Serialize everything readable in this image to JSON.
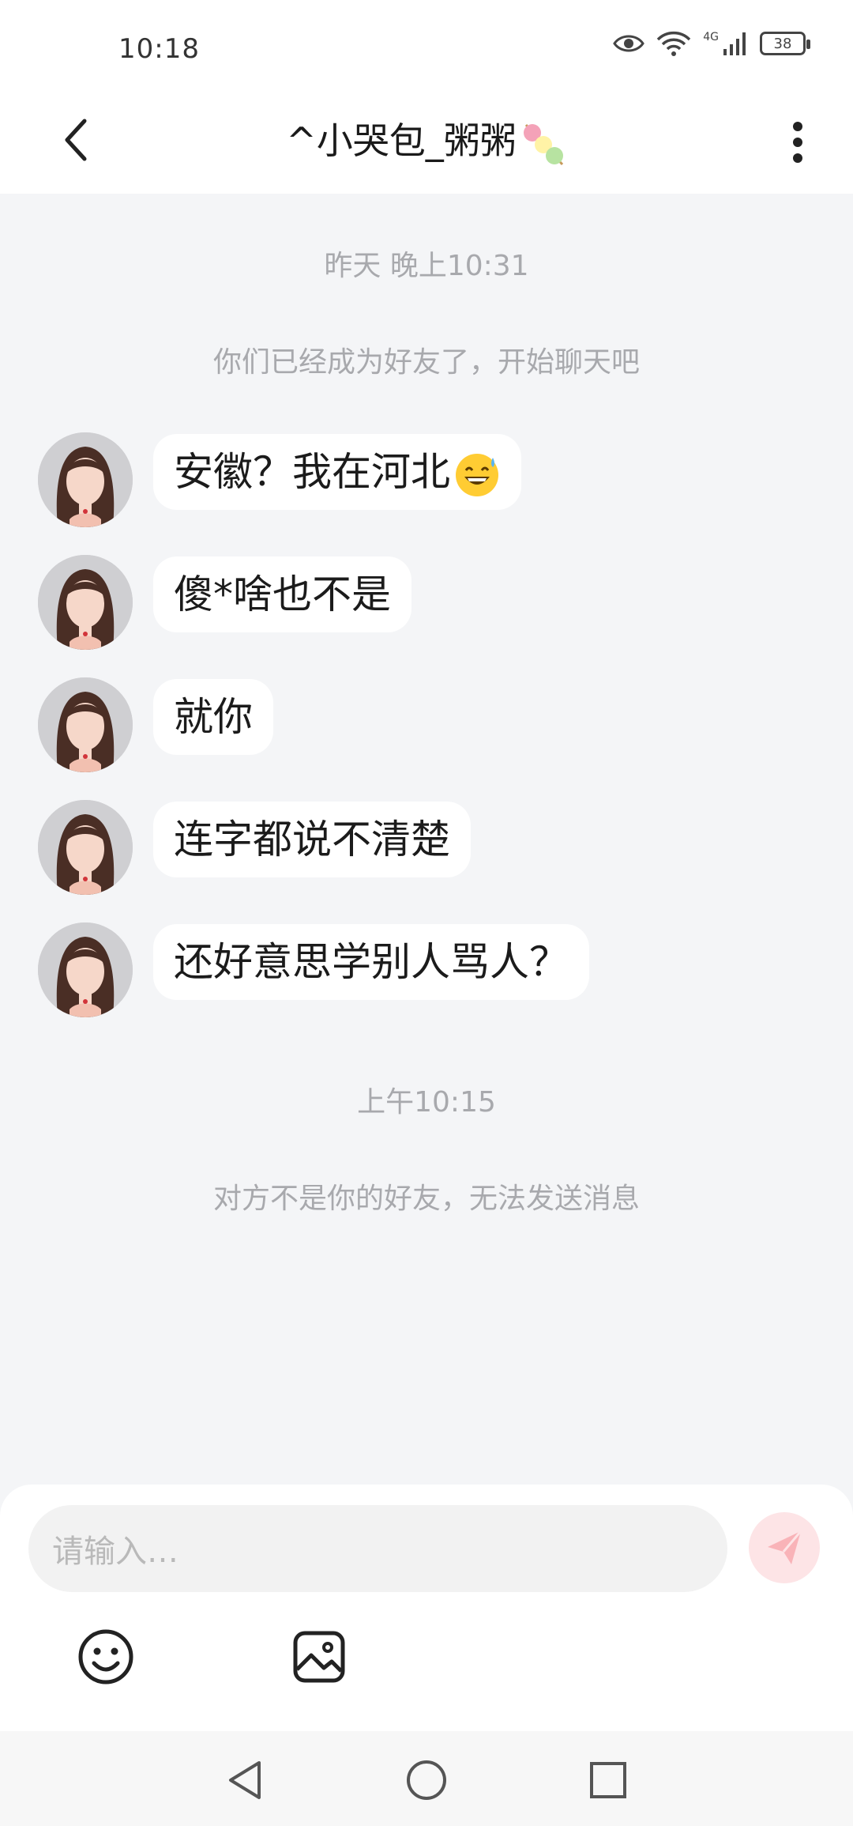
{
  "status_bar": {
    "time": "10:18",
    "battery": "38",
    "network": "4G"
  },
  "header": {
    "title": "^小哭包_粥粥",
    "back_icon": "chevron-left-icon",
    "more_icon": "more-vertical-icon"
  },
  "chat": {
    "timestamp_1": "昨天 晚上10:31",
    "notice_1": "你们已经成为好友了，开始聊天吧",
    "messages": [
      {
        "text": "安徽？我在河北"
      },
      {
        "text": "傻*啥也不是"
      },
      {
        "text": "就你"
      },
      {
        "text": "连字都说不清楚"
      },
      {
        "text": "还好意思学别人骂人？"
      }
    ],
    "timestamp_2": "上午10:15",
    "notice_2": "对方不是你的好友，无法发送消息"
  },
  "composer": {
    "placeholder": "请输入…",
    "send_icon": "send-icon",
    "emoji_icon": "smiley-icon",
    "image_icon": "image-icon"
  },
  "colors": {
    "background": "#f4f5f7",
    "bubble": "#ffffff",
    "send_button": "#fde4e6",
    "send_icon": "#f9b3b8",
    "system_text": "#a8a9ad"
  }
}
